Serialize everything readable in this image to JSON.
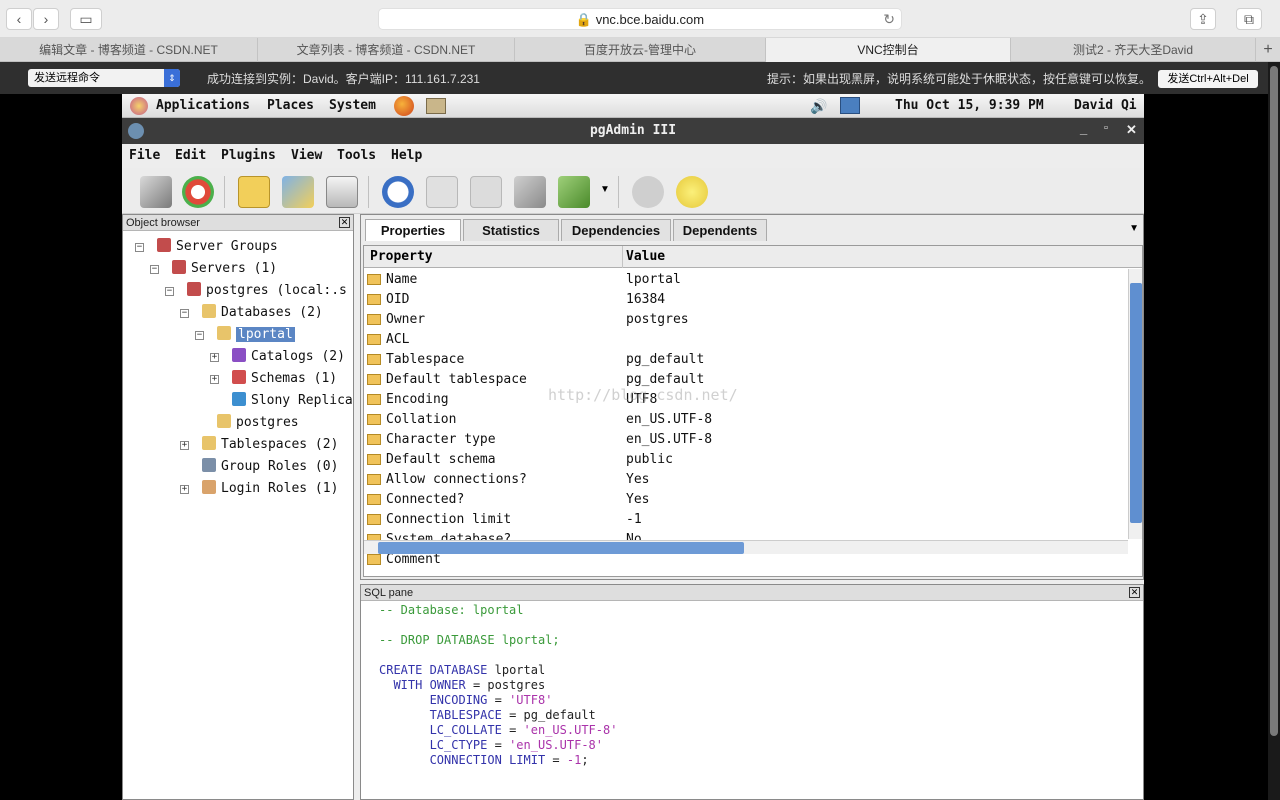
{
  "browser": {
    "url": "vnc.bce.baidu.com",
    "tabs": [
      {
        "label": "编辑文章 - 博客频道 - CSDN.NET",
        "active": false
      },
      {
        "label": "文章列表 - 博客频道 - CSDN.NET",
        "active": false
      },
      {
        "label": "百度开放云-管理中心",
        "active": false
      },
      {
        "label": "VNC控制台",
        "active": true
      },
      {
        "label": "测试2 - 齐天大圣David",
        "active": false
      }
    ],
    "new_tab": "+"
  },
  "vnc": {
    "remote_command": "发送远程命令",
    "status": "成功连接到实例：David。客户端IP：111.161.7.231",
    "hint": "提示：如果出现黑屏，说明系统可能处于休眠状态，按任意键可以恢复。",
    "cad_button": "发送Ctrl+Alt+Del"
  },
  "gnome_panel": {
    "applications": "Applications",
    "places": "Places",
    "system": "System",
    "datetime": "Thu Oct 15,  9:39 PM",
    "user": "David Qi"
  },
  "window": {
    "title": "pgAdmin III",
    "minimize": "_",
    "maximize": "▫",
    "close": "✕"
  },
  "menu": [
    "File",
    "Edit",
    "Plugins",
    "View",
    "Tools",
    "Help"
  ],
  "toolbar": {
    "icons": [
      "plug-icon",
      "refresh-icon",
      "properties-icon",
      "create-icon",
      "trash-icon",
      "sql-icon",
      "table-icon",
      "data-filter-icon",
      "wrench-icon",
      "plugins-icon",
      "hint-icon",
      "help-icon"
    ]
  },
  "object_browser": {
    "header": "Object browser",
    "close": "✕",
    "tree": [
      {
        "label": "Server Groups",
        "level": 0,
        "expander": "-",
        "icon": "server-groups-icon",
        "color": "#c24c4c"
      },
      {
        "label": "Servers (1)",
        "level": 1,
        "expander": "-",
        "icon": "servers-icon",
        "color": "#c24c4c"
      },
      {
        "label": "postgres (local:.s",
        "level": 2,
        "expander": "-",
        "icon": "server-icon",
        "color": "#c24c4c"
      },
      {
        "label": "Databases (2)",
        "level": 3,
        "expander": "-",
        "icon": "databases-icon",
        "color": "#e8c46a"
      },
      {
        "label": "lportal",
        "level": 4,
        "expander": "-",
        "icon": "database-icon",
        "color": "#e8c46a",
        "selected": true
      },
      {
        "label": "Catalogs (2)",
        "level": 5,
        "expander": "+",
        "icon": "catalogs-icon",
        "color": "#8a4fc4"
      },
      {
        "label": "Schemas (1)",
        "level": 5,
        "expander": "+",
        "icon": "schemas-icon",
        "color": "#d14d4d"
      },
      {
        "label": "Slony Replica",
        "level": 5,
        "expander": "",
        "icon": "slony-icon",
        "color": "#3c8fd0"
      },
      {
        "label": "postgres",
        "level": 4,
        "expander": "",
        "icon": "database-icon",
        "color": "#e8c46a"
      },
      {
        "label": "Tablespaces (2)",
        "level": 3,
        "expander": "+",
        "icon": "tablespaces-icon",
        "color": "#e8c46a"
      },
      {
        "label": "Group Roles (0)",
        "level": 3,
        "expander": "",
        "icon": "group-roles-icon",
        "color": "#7b8fa8"
      },
      {
        "label": "Login Roles (1)",
        "level": 3,
        "expander": "+",
        "icon": "login-roles-icon",
        "color": "#d9a36b"
      }
    ]
  },
  "properties": {
    "tabs": [
      "Properties",
      "Statistics",
      "Dependencies",
      "Dependents"
    ],
    "col_property": "Property",
    "col_value": "Value",
    "rows": [
      {
        "k": "Name",
        "v": "lportal"
      },
      {
        "k": "OID",
        "v": "16384"
      },
      {
        "k": "Owner",
        "v": "postgres"
      },
      {
        "k": "ACL",
        "v": ""
      },
      {
        "k": "Tablespace",
        "v": "pg_default"
      },
      {
        "k": "Default tablespace",
        "v": "pg_default"
      },
      {
        "k": "Encoding",
        "v": "UTF8"
      },
      {
        "k": "Collation",
        "v": "en_US.UTF-8"
      },
      {
        "k": "Character type",
        "v": "en_US.UTF-8"
      },
      {
        "k": "Default schema",
        "v": "public"
      },
      {
        "k": "Allow connections?",
        "v": "Yes"
      },
      {
        "k": "Connected?",
        "v": "Yes"
      },
      {
        "k": "Connection limit",
        "v": "-1"
      },
      {
        "k": "System database?",
        "v": "No"
      },
      {
        "k": "Comment",
        "v": ""
      }
    ],
    "watermark": "http://blog.csdn.net/"
  },
  "sql": {
    "header": "SQL pane",
    "close": "✕",
    "lines": [
      "-- Database: lportal",
      "",
      "-- DROP DATABASE lportal;",
      "",
      "CREATE DATABASE lportal",
      "  WITH OWNER = postgres",
      "       ENCODING = 'UTF8'",
      "       TABLESPACE = pg_default",
      "       LC_COLLATE = 'en_US.UTF-8'",
      "       LC_CTYPE = 'en_US.UTF-8'",
      "       CONNECTION LIMIT = -1;"
    ]
  }
}
